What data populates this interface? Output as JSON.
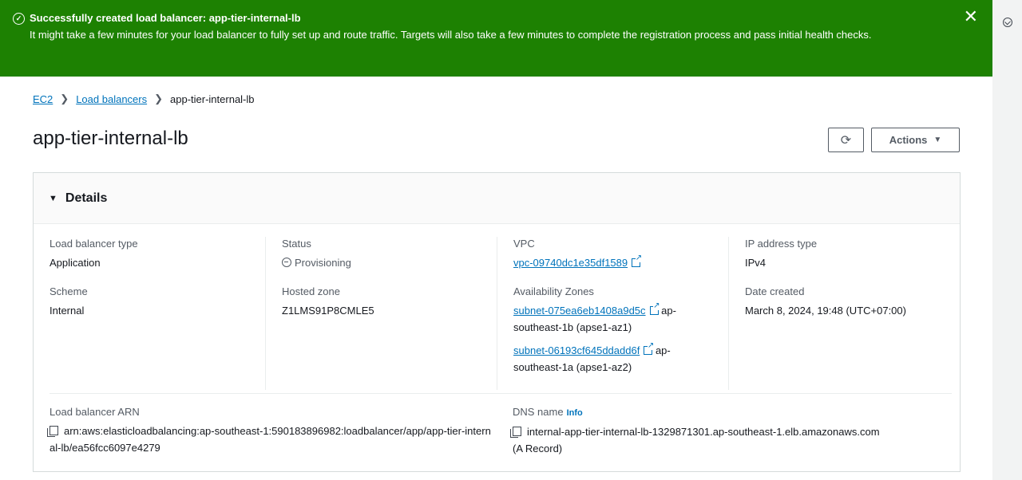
{
  "flash": {
    "title": "Successfully created load balancer: app-tier-internal-lb",
    "message": "It might take a few minutes for your load balancer to fully set up and route traffic. Targets will also take a few minutes to complete the registration process and pass initial health checks.",
    "close": "✕"
  },
  "breadcrumb": {
    "ec2": "EC2",
    "load_balancers": "Load balancers",
    "current": "app-tier-internal-lb"
  },
  "page": {
    "title": "app-tier-internal-lb",
    "refresh_icon": "⟳",
    "actions_label": "Actions",
    "actions_caret": "▼"
  },
  "details": {
    "header": "Details",
    "header_icon": "▼",
    "load_balancer_type": {
      "label": "Load balancer type",
      "value": "Application"
    },
    "scheme": {
      "label": "Scheme",
      "value": "Internal"
    },
    "status": {
      "label": "Status",
      "value": "Provisioning"
    },
    "hosted_zone": {
      "label": "Hosted zone",
      "value": "Z1LMS91P8CMLE5"
    },
    "vpc": {
      "label": "VPC",
      "value": "vpc-09740dc1e35df1589"
    },
    "availability_zones": {
      "label": "Availability Zones",
      "items": [
        {
          "subnet": "subnet-075ea6eb1408a9d5c",
          "suffix": "ap-southeast-1b (apse1-az1)"
        },
        {
          "subnet": "subnet-06193cf645ddadd6f",
          "suffix": "ap-southeast-1a (apse1-az2)"
        }
      ]
    },
    "ip_address_type": {
      "label": "IP address type",
      "value": "IPv4"
    },
    "date_created": {
      "label": "Date created",
      "value": "March 8, 2024, 19:48 (UTC+07:00)"
    },
    "arn": {
      "label": "Load balancer ARN",
      "value": "arn:aws:elasticloadbalancing:ap-southeast-1:590183896982:loadbalancer/app/app-tier-internal-lb/ea56fcc6097e4279"
    },
    "dns": {
      "label": "DNS name",
      "info": "Info",
      "value": "internal-app-tier-internal-lb-1329871301.ap-southeast-1.elb.amazonaws.com",
      "record": "(A Record)"
    }
  }
}
